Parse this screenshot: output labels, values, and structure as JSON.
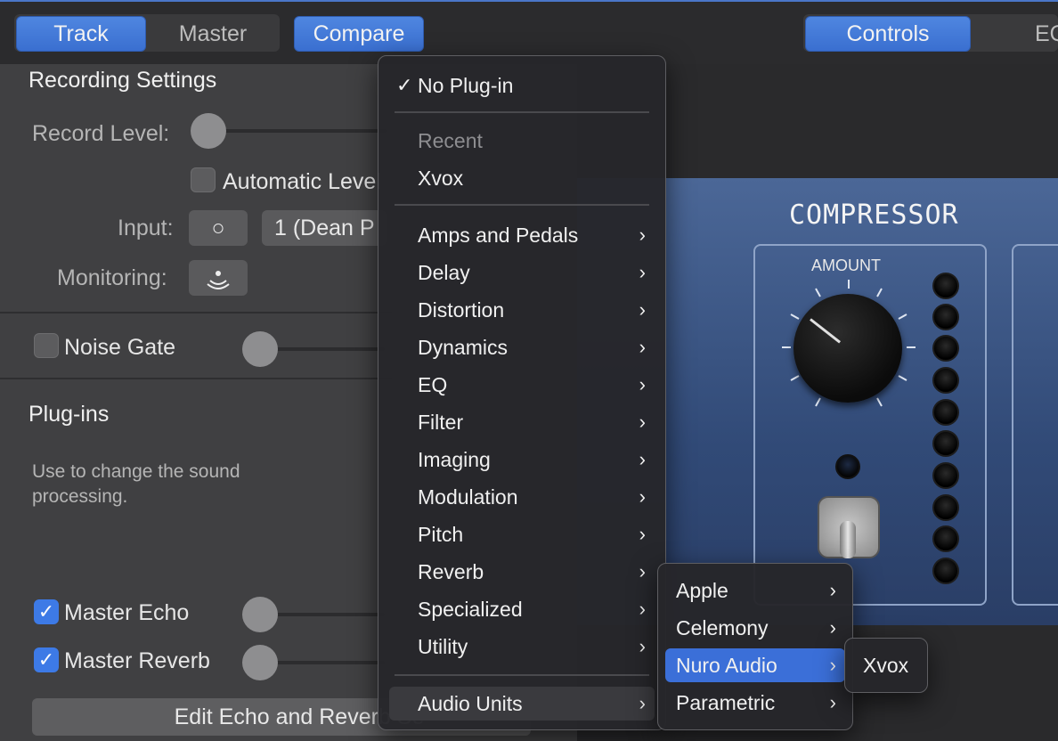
{
  "topbar": {
    "track": "Track",
    "master": "Master",
    "compare": "Compare",
    "controls": "Controls",
    "eq_partial": "EQ"
  },
  "recording": {
    "title": "Recording Settings",
    "record_level": "Record Level:",
    "automatic_level": "Automatic Level",
    "input_label": "Input:",
    "input_icon": "○",
    "input_value": "1  (Dean P",
    "monitoring_label": "Monitoring:"
  },
  "noise_gate": {
    "label": "Noise Gate"
  },
  "plugins": {
    "title": "Plug-ins",
    "description": "Use to change the sound processing."
  },
  "master_echo": {
    "label": "Master Echo",
    "checked": true
  },
  "master_reverb": {
    "label": "Master Reverb",
    "checked": true
  },
  "edit_button": "Edit Echo and Reverb Se",
  "compressor": {
    "title": "COMPRESSOR",
    "amount_label": "AMOUNT"
  },
  "menu": {
    "no_plugin": "No Plug-in",
    "recent_header": "Recent",
    "recent_item": "Xvox",
    "categories": [
      "Amps and Pedals",
      "Delay",
      "Distortion",
      "Dynamics",
      "EQ",
      "Filter",
      "Imaging",
      "Modulation",
      "Pitch",
      "Reverb",
      "Specialized",
      "Utility"
    ],
    "audio_units": "Audio Units",
    "chevron": "›",
    "check": "✓"
  },
  "submenu": {
    "items": [
      "Apple",
      "Celemony",
      "Nuro Audio",
      "Parametric"
    ],
    "highlighted": "Nuro Audio"
  },
  "subsubmenu": {
    "items": [
      "Xvox"
    ]
  },
  "colors": {
    "accent": "#3b6fd8",
    "plugin_blue": "#3a5280"
  }
}
